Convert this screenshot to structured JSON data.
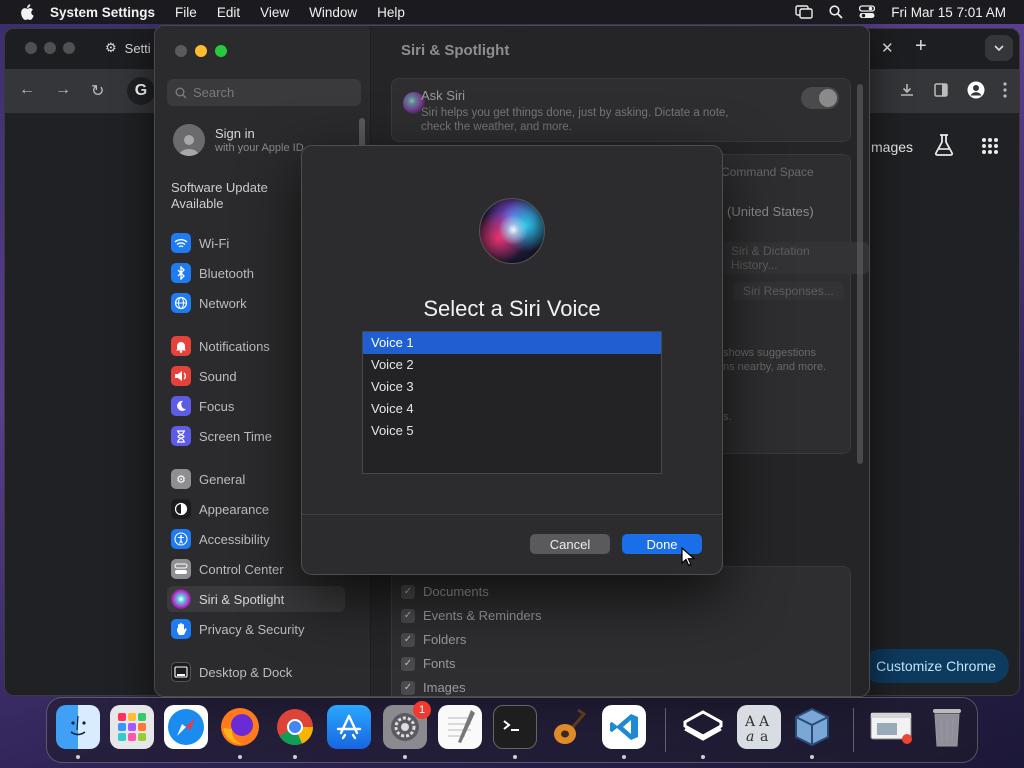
{
  "menubar": {
    "app_name": "System Settings",
    "menus": [
      "File",
      "Edit",
      "View",
      "Window",
      "Help"
    ],
    "datetime": "Fri Mar 15  7:01 AM"
  },
  "chrome": {
    "tab_title": "Setti",
    "images_link": "mages",
    "customize_label": "Customize Chrome",
    "google_letter": "G"
  },
  "settings": {
    "search_placeholder": "Search",
    "signin_title": "Sign in",
    "signin_subtitle": "with your Apple ID",
    "update_notice": "Software Update Available",
    "sidebar": [
      {
        "label": "Wi-Fi",
        "icon": "wifi-icon",
        "color": "#1e7bf2"
      },
      {
        "label": "Bluetooth",
        "icon": "bluetooth-icon",
        "color": "#1e7bf2"
      },
      {
        "label": "Network",
        "icon": "globe-icon",
        "color": "#1e7bf2"
      },
      {
        "label": "Notifications",
        "icon": "bell-icon",
        "color": "#e5423c"
      },
      {
        "label": "Sound",
        "icon": "speaker-icon",
        "color": "#e5423c"
      },
      {
        "label": "Focus",
        "icon": "moon-icon",
        "color": "#5e5ce6"
      },
      {
        "label": "Screen Time",
        "icon": "hourglass-icon",
        "color": "#5e5ce6"
      },
      {
        "label": "General",
        "icon": "gear-icon",
        "color": "#8e8e93"
      },
      {
        "label": "Appearance",
        "icon": "appearance-icon",
        "color": "#1c1c1e"
      },
      {
        "label": "Accessibility",
        "icon": "accessibility-icon",
        "color": "#1e7bf2"
      },
      {
        "label": "Control Center",
        "icon": "control-center-icon",
        "color": "#8e8e93"
      },
      {
        "label": "Siri & Spotlight",
        "icon": "siri-icon",
        "color": "#7a3fd0"
      },
      {
        "label": "Privacy & Security",
        "icon": "hand-icon",
        "color": "#1e7bf2"
      },
      {
        "label": "Desktop & Dock",
        "icon": "dock-icon",
        "color": "#1c1c1e"
      }
    ],
    "header": "Siri & Spotlight",
    "ask_siri_title": "Ask Siri",
    "ask_siri_desc": "Siri helps you get things done, just by asking. Dictate a note, check the weather, and more.",
    "faded_shortcut": "Command Space",
    "faded_language": "(United States)",
    "faded_history": "Siri & Dictation History...",
    "faded_responses": "Siri Responses...",
    "faded_suggest_1": "shows suggestions",
    "faded_suggest_2": "ns nearby, and more.",
    "faded_dot": "s.",
    "checks": [
      "Documents",
      "Events & Reminders",
      "Folders",
      "Fonts",
      "Images"
    ]
  },
  "modal": {
    "title": "Select a Siri Voice",
    "voices": [
      "Voice 1",
      "Voice 2",
      "Voice 3",
      "Voice 4",
      "Voice 5"
    ],
    "selected_index": 0,
    "cancel_label": "Cancel",
    "done_label": "Done"
  },
  "dock": {
    "apps": [
      "Finder",
      "Launchpad",
      "Safari",
      "Firefox",
      "Chrome",
      "App Store",
      "System Settings",
      "TextEdit",
      "Terminal",
      "GarageBand",
      "Visual Studio Code",
      "Sublime Merge",
      "Font Book",
      "VirtualBox",
      "Preview",
      "Trash"
    ],
    "settings_badge": "1"
  }
}
